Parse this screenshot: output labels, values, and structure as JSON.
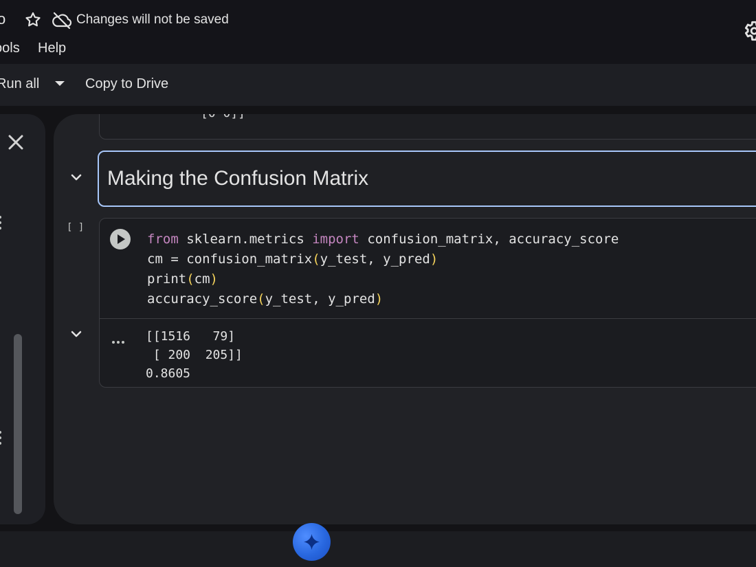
{
  "header": {
    "title_fragment": "o",
    "save_status": "Changes will not be saved",
    "menus": [
      "ools",
      "Help"
    ]
  },
  "toolbar": {
    "run_all_label": "Run all",
    "copy_to_drive_label": "Copy to Drive"
  },
  "notebook": {
    "previous_output_tail": "[0 0]]",
    "text_cell": {
      "heading": "Making the Confusion Matrix"
    },
    "code_cell": {
      "execution_count": "[ ]",
      "lines": [
        {
          "kw1": "from",
          "a": " sklearn.metrics ",
          "kw2": "import",
          "b": " confusion_matrix, accuracy_score"
        },
        {
          "a": "cm = confusion_matrix",
          "p1": "(",
          "b": "y_test, y_pred",
          "p2": ")"
        },
        {
          "a": "print",
          "p1": "(",
          "b": "cm",
          "p2": ")"
        },
        {
          "a": "accuracy_score",
          "p1": "(",
          "b": "y_test, y_pred",
          "p2": ")"
        }
      ],
      "output_lines": [
        "[[1516   79]",
        " [ 200  205]]",
        "0.8605"
      ]
    }
  },
  "colors": {
    "accent": "#a8c7fa",
    "keyword": "#c586c0",
    "bracket": "#f5d35b",
    "gemini": "#2867df"
  },
  "icons": [
    "star-icon",
    "cloud-off-icon",
    "gear-icon",
    "close-icon",
    "chevron-down-icon",
    "run-icon",
    "more-icon",
    "sparkle-icon"
  ]
}
